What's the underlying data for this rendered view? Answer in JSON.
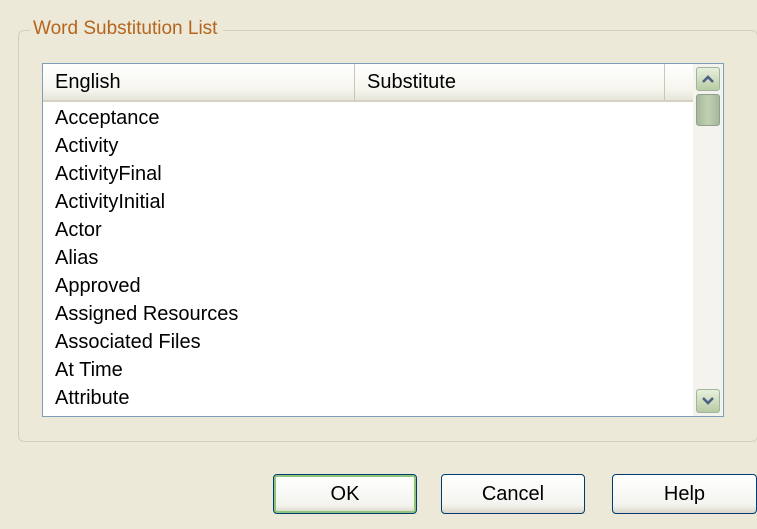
{
  "group": {
    "title": "Word Substitution List"
  },
  "list": {
    "columns": [
      "English",
      "Substitute"
    ],
    "rows": [
      {
        "english": "Acceptance",
        "substitute": ""
      },
      {
        "english": "Activity",
        "substitute": ""
      },
      {
        "english": "ActivityFinal",
        "substitute": ""
      },
      {
        "english": "ActivityInitial",
        "substitute": ""
      },
      {
        "english": "Actor",
        "substitute": ""
      },
      {
        "english": "Alias",
        "substitute": ""
      },
      {
        "english": "Approved",
        "substitute": ""
      },
      {
        "english": "Assigned Resources",
        "substitute": ""
      },
      {
        "english": "Associated Files",
        "substitute": ""
      },
      {
        "english": "At Time",
        "substitute": ""
      },
      {
        "english": "Attribute",
        "substitute": ""
      }
    ]
  },
  "scrollbar": {
    "up_icon": "chevron-up-icon",
    "down_icon": "chevron-down-icon"
  },
  "buttons": {
    "ok": "OK",
    "cancel": "Cancel",
    "help": "Help"
  },
  "colors": {
    "dialog_background": "#ECE9D8",
    "group_title": "#B5651D",
    "focus_highlight": "#8FC47A",
    "button_border": "#003C74"
  }
}
